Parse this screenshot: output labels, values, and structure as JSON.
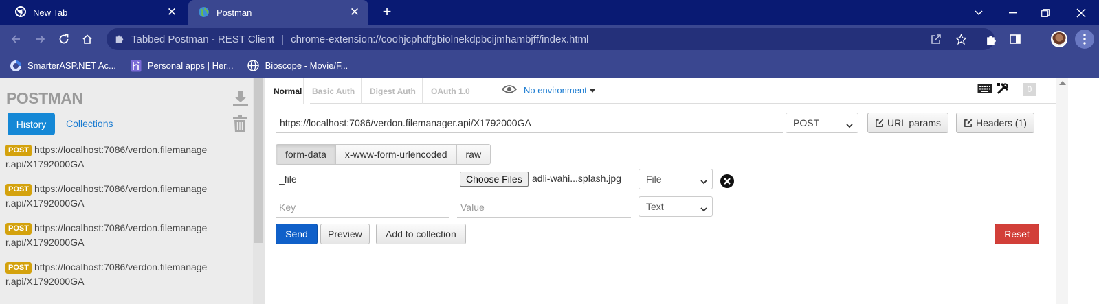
{
  "browser": {
    "tabs": [
      {
        "label": "New Tab",
        "icon": "chrome-icon",
        "active": false
      },
      {
        "label": "Postman",
        "icon": "globe-icon",
        "active": true
      }
    ],
    "omnibox": {
      "site_name": "Tabbed Postman - REST Client",
      "url": "chrome-extension://coohjcphdfgbiolnekdpbcijmhambjff/index.html"
    },
    "bookmarks": [
      {
        "label": "SmarterASP.NET Ac...",
        "icon": "smarterasp-icon"
      },
      {
        "label": "Personal apps | Her...",
        "icon": "heroku-icon"
      },
      {
        "label": "Bioscope - Movie/F...",
        "icon": "globe-icon"
      }
    ]
  },
  "sidebar": {
    "logo": "POSTMAN",
    "tabs": {
      "history": "History",
      "collections": "Collections"
    },
    "history": [
      {
        "method": "POST",
        "line1": "https://localhost:7086/verdon.filemanage",
        "line2": "r.api/X1792000GA"
      },
      {
        "method": "POST",
        "line1": "https://localhost:7086/verdon.filemanage",
        "line2": "r.api/X1792000GA"
      },
      {
        "method": "POST",
        "line1": "https://localhost:7086/verdon.filemanage",
        "line2": "r.api/X1792000GA"
      },
      {
        "method": "POST",
        "line1": "https://localhost:7086/verdon.filemanage",
        "line2": "r.api/X1792000GA"
      }
    ]
  },
  "request": {
    "auth_tabs": [
      "Normal",
      "Basic Auth",
      "Digest Auth",
      "OAuth 1.0"
    ],
    "environment": "No environment",
    "count_badge": "0",
    "url": "https://localhost:7086/verdon.filemanager.api/X1792000GA",
    "method": "POST",
    "url_params_label": "URL params",
    "headers_label": "Headers (1)",
    "body_tabs": [
      "form-data",
      "x-www-form-urlencoded",
      "raw"
    ],
    "form": {
      "row1": {
        "key": "_file",
        "choose_files": "Choose Files",
        "filename": "adli-wahi...splash.jpg",
        "type": "File"
      },
      "row2": {
        "key_placeholder": "Key",
        "value_placeholder": "Value",
        "type": "Text"
      }
    },
    "buttons": {
      "send": "Send",
      "preview": "Preview",
      "add_to_collection": "Add to collection",
      "reset": "Reset"
    }
  },
  "colors": {
    "tabstrip": "#091a73",
    "toolbar": "#3a4790",
    "send": "#1060c9",
    "reset": "#d23f39",
    "history_tab": "#1588d6",
    "post_badge": "#d4a20d"
  }
}
